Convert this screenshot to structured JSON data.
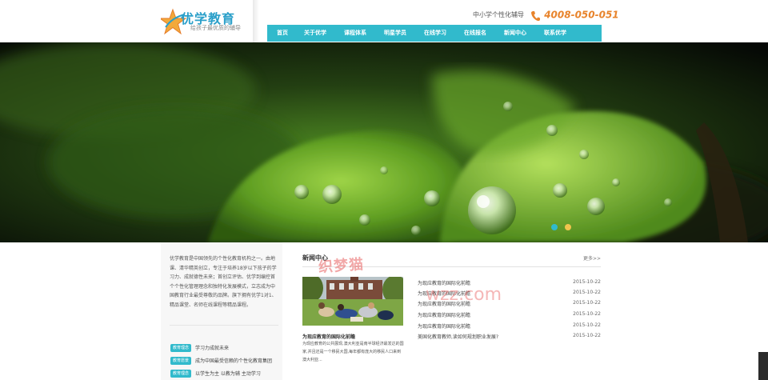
{
  "header": {
    "logo_title": "优学教育",
    "logo_subtitle": "给孩子最优质的辅导",
    "hotline_label": "中小学个性化辅导",
    "hotline_number": "4008-050-051"
  },
  "nav": {
    "items": [
      "首页",
      "关于优学",
      "课程体系",
      "明星学员",
      "在线学习",
      "在线报名",
      "新闻中心",
      "联系优学"
    ]
  },
  "banner": {
    "dot_colors": [
      "#31bacc",
      "#f0c44e"
    ]
  },
  "intro": {
    "text": "优学教育是中国领先的个性化教育机构之一。由地课、清华精英创立，专注于培养18岁以下孩子的学习力、成就德性未来；首创立评估、优学到编控首个个性化管理理念和独特化发展模式，立志成为中国教育行业最受尊敬的品牌。旗下拥有优学1对1、精品课堂、名师在线课程等精品课程。",
    "tags": [
      {
        "badge": "教育理念",
        "text": "学习力成就未来"
      },
      {
        "badge": "教育愿景",
        "text": "成为中国最受信赖的个性化教育集团"
      },
      {
        "badge": "教育理念",
        "text": "以学生为主 以教为辅 主动学习"
      }
    ]
  },
  "news": {
    "title": "新闻中心",
    "more": "更多>>",
    "featured_caption": "为现应教育的国际化前瞻",
    "featured_summary": "为现应教育的公共展现,澳大利亚是南半球经济最发达的国家,并且还是一个移民大国,每年都有庞大的移民人口来到澳大利亚...",
    "items": [
      {
        "title": "为现应教育的国际化前瞻",
        "date": "2015-10-22"
      },
      {
        "title": "为现应教育的国际化前瞻",
        "date": "2015-10-22"
      },
      {
        "title": "为现应教育的国际化前瞻",
        "date": "2015-10-22"
      },
      {
        "title": "为现应教育的国际化前瞻",
        "date": "2015-10-22"
      },
      {
        "title": "为现应教育的国际化前瞻",
        "date": "2015-10-22"
      },
      {
        "title": "美国化教育教师,读如何规划职业发展?",
        "date": "2015-10-22"
      }
    ]
  },
  "watermark": {
    "text1": "织梦猫",
    "text2": "wzz.com"
  },
  "colors": {
    "accent": "#31bacc",
    "brand": "#2a9fc9",
    "hotline": "#e8842c"
  }
}
